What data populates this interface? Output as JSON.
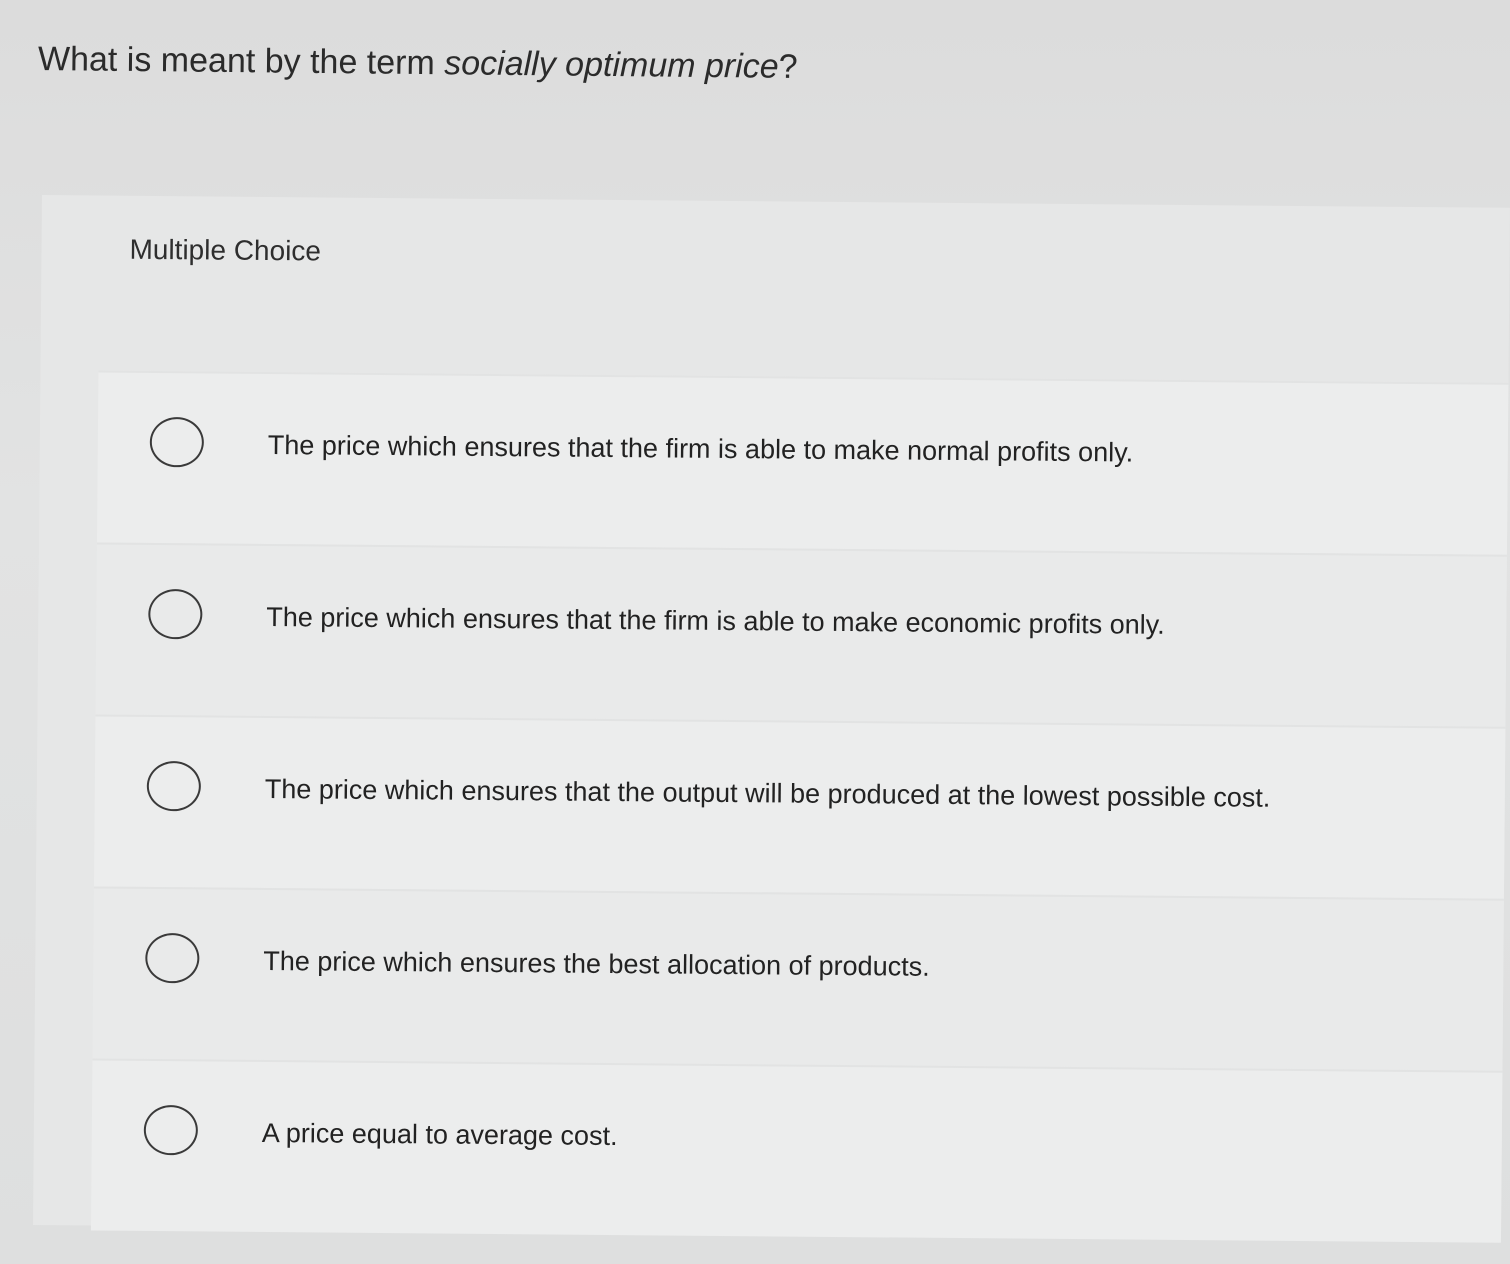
{
  "question": {
    "prefix": "What is meant by the term ",
    "emphasis": "socially optimum price",
    "suffix": "?"
  },
  "multiple_choice_label": "Multiple Choice",
  "options": [
    "The price which ensures that the firm is able to make normal profits only.",
    "The price which ensures that the firm is able to make economic profits only.",
    "The price which ensures that the output will be produced at the lowest possible cost.",
    "The price which ensures the best allocation of products.",
    "A price equal to average cost."
  ]
}
